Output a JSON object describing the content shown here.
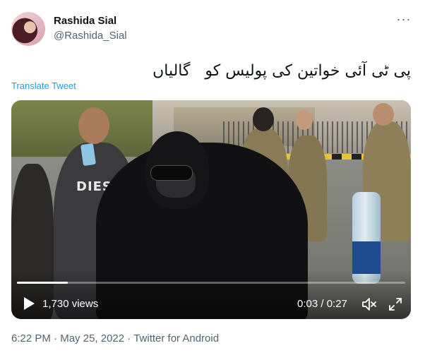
{
  "author": {
    "display_name": "Rashida Sial",
    "handle": "@Rashida_Sial",
    "avatar_icon": "profile-photo"
  },
  "more_icon": "more-horizontal-icon",
  "tweet": {
    "text": "پی ٹی آئی خواتین کی پولیس کو   گالیاں",
    "translate_label": "Translate Tweet"
  },
  "video": {
    "views": "1,730 views",
    "time": "0:03 / 0:27",
    "progress": 0.13,
    "shirt_text": "DIESEL",
    "icons": [
      "play-icon",
      "volume-icon",
      "fullscreen-icon"
    ]
  },
  "meta": {
    "time": "6:22 PM",
    "separator1": " · ",
    "date": "May 25, 2022",
    "separator2": " · ",
    "source": "Twitter for Android"
  },
  "colors": {
    "link": "#1d9bf0",
    "secondary_text": "#536471",
    "primary_text": "#0f1419"
  }
}
